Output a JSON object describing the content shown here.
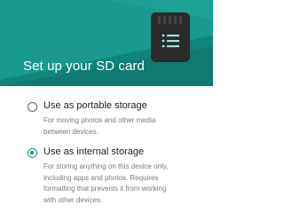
{
  "header": {
    "title": "Set up your SD card",
    "background_dark": "#0f6f68",
    "background_light": "#1a9a8e"
  },
  "icons": {
    "illustration": "sd-card-icon"
  },
  "options": [
    {
      "label": "Use as portable storage",
      "description_lines": [
        "For moving photos and other media",
        "between devices."
      ],
      "selected": false
    },
    {
      "label": "Use as internal storage",
      "description_lines": [
        "For storing anything on this device only,",
        "including apps and photos. Requires",
        "formatting that prevents it from working",
        "with other devices."
      ],
      "selected": true
    }
  ],
  "accent_color": "#139488"
}
